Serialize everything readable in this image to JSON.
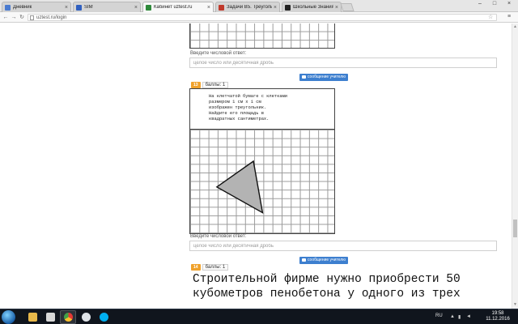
{
  "browser": {
    "tabs": [
      {
        "label": "Дневник",
        "favicon_color": "#4a7bd0",
        "active": false
      },
      {
        "label": "SIM",
        "favicon_color": "#3060c0",
        "active": false
      },
      {
        "label": "Кабинет uztest.ru",
        "favicon_color": "#2f8a3b",
        "active": true
      },
      {
        "label": "Задачи B5. Треугольник",
        "favicon_color": "#c0392b",
        "active": false
      },
      {
        "label": "Школьные Знания.com",
        "favicon_color": "#222222",
        "active": false
      }
    ],
    "url": "uztest.ru/login"
  },
  "page": {
    "answer_label": "Введите числовой ответ:",
    "answer_placeholder": "целое число или десятичная дробь",
    "message_button_label": "сообщение учителю",
    "tasks": [
      {
        "number": "13",
        "points": "баллы: 1",
        "text_lines": [
          "На клетчатой бумаге с клетками",
          "размером 1 см х 1 см",
          "изображен треугольник.",
          "Найдите его площадь в",
          "квадратных сантиметрах."
        ]
      },
      {
        "number": "14",
        "points": "баллы: 1",
        "big_text_lines": [
          "Строительной фирме нужно приобрести 50",
          "кубометров пенобетона у одного из трех"
        ]
      }
    ],
    "triangle_cells": [
      [
        3,
        3
      ],
      [
        7,
        0
      ],
      [
        8,
        6
      ]
    ]
  },
  "taskbar": {
    "apps": [
      {
        "name": "explorer",
        "color": "#e8b84a"
      },
      {
        "name": "media",
        "color": "#d8d8d8"
      },
      {
        "name": "chrome",
        "color": "#4caf50"
      },
      {
        "name": "steam",
        "color": "#1b2838"
      },
      {
        "name": "skype",
        "color": "#00aff0"
      }
    ],
    "language": "RU",
    "time": "19:58",
    "date": "11.12.2016"
  },
  "colors": {
    "accent_button": "#3d7fcf",
    "task_badge": "#f0a22c",
    "triangle_fill": "#b3b3b3"
  }
}
